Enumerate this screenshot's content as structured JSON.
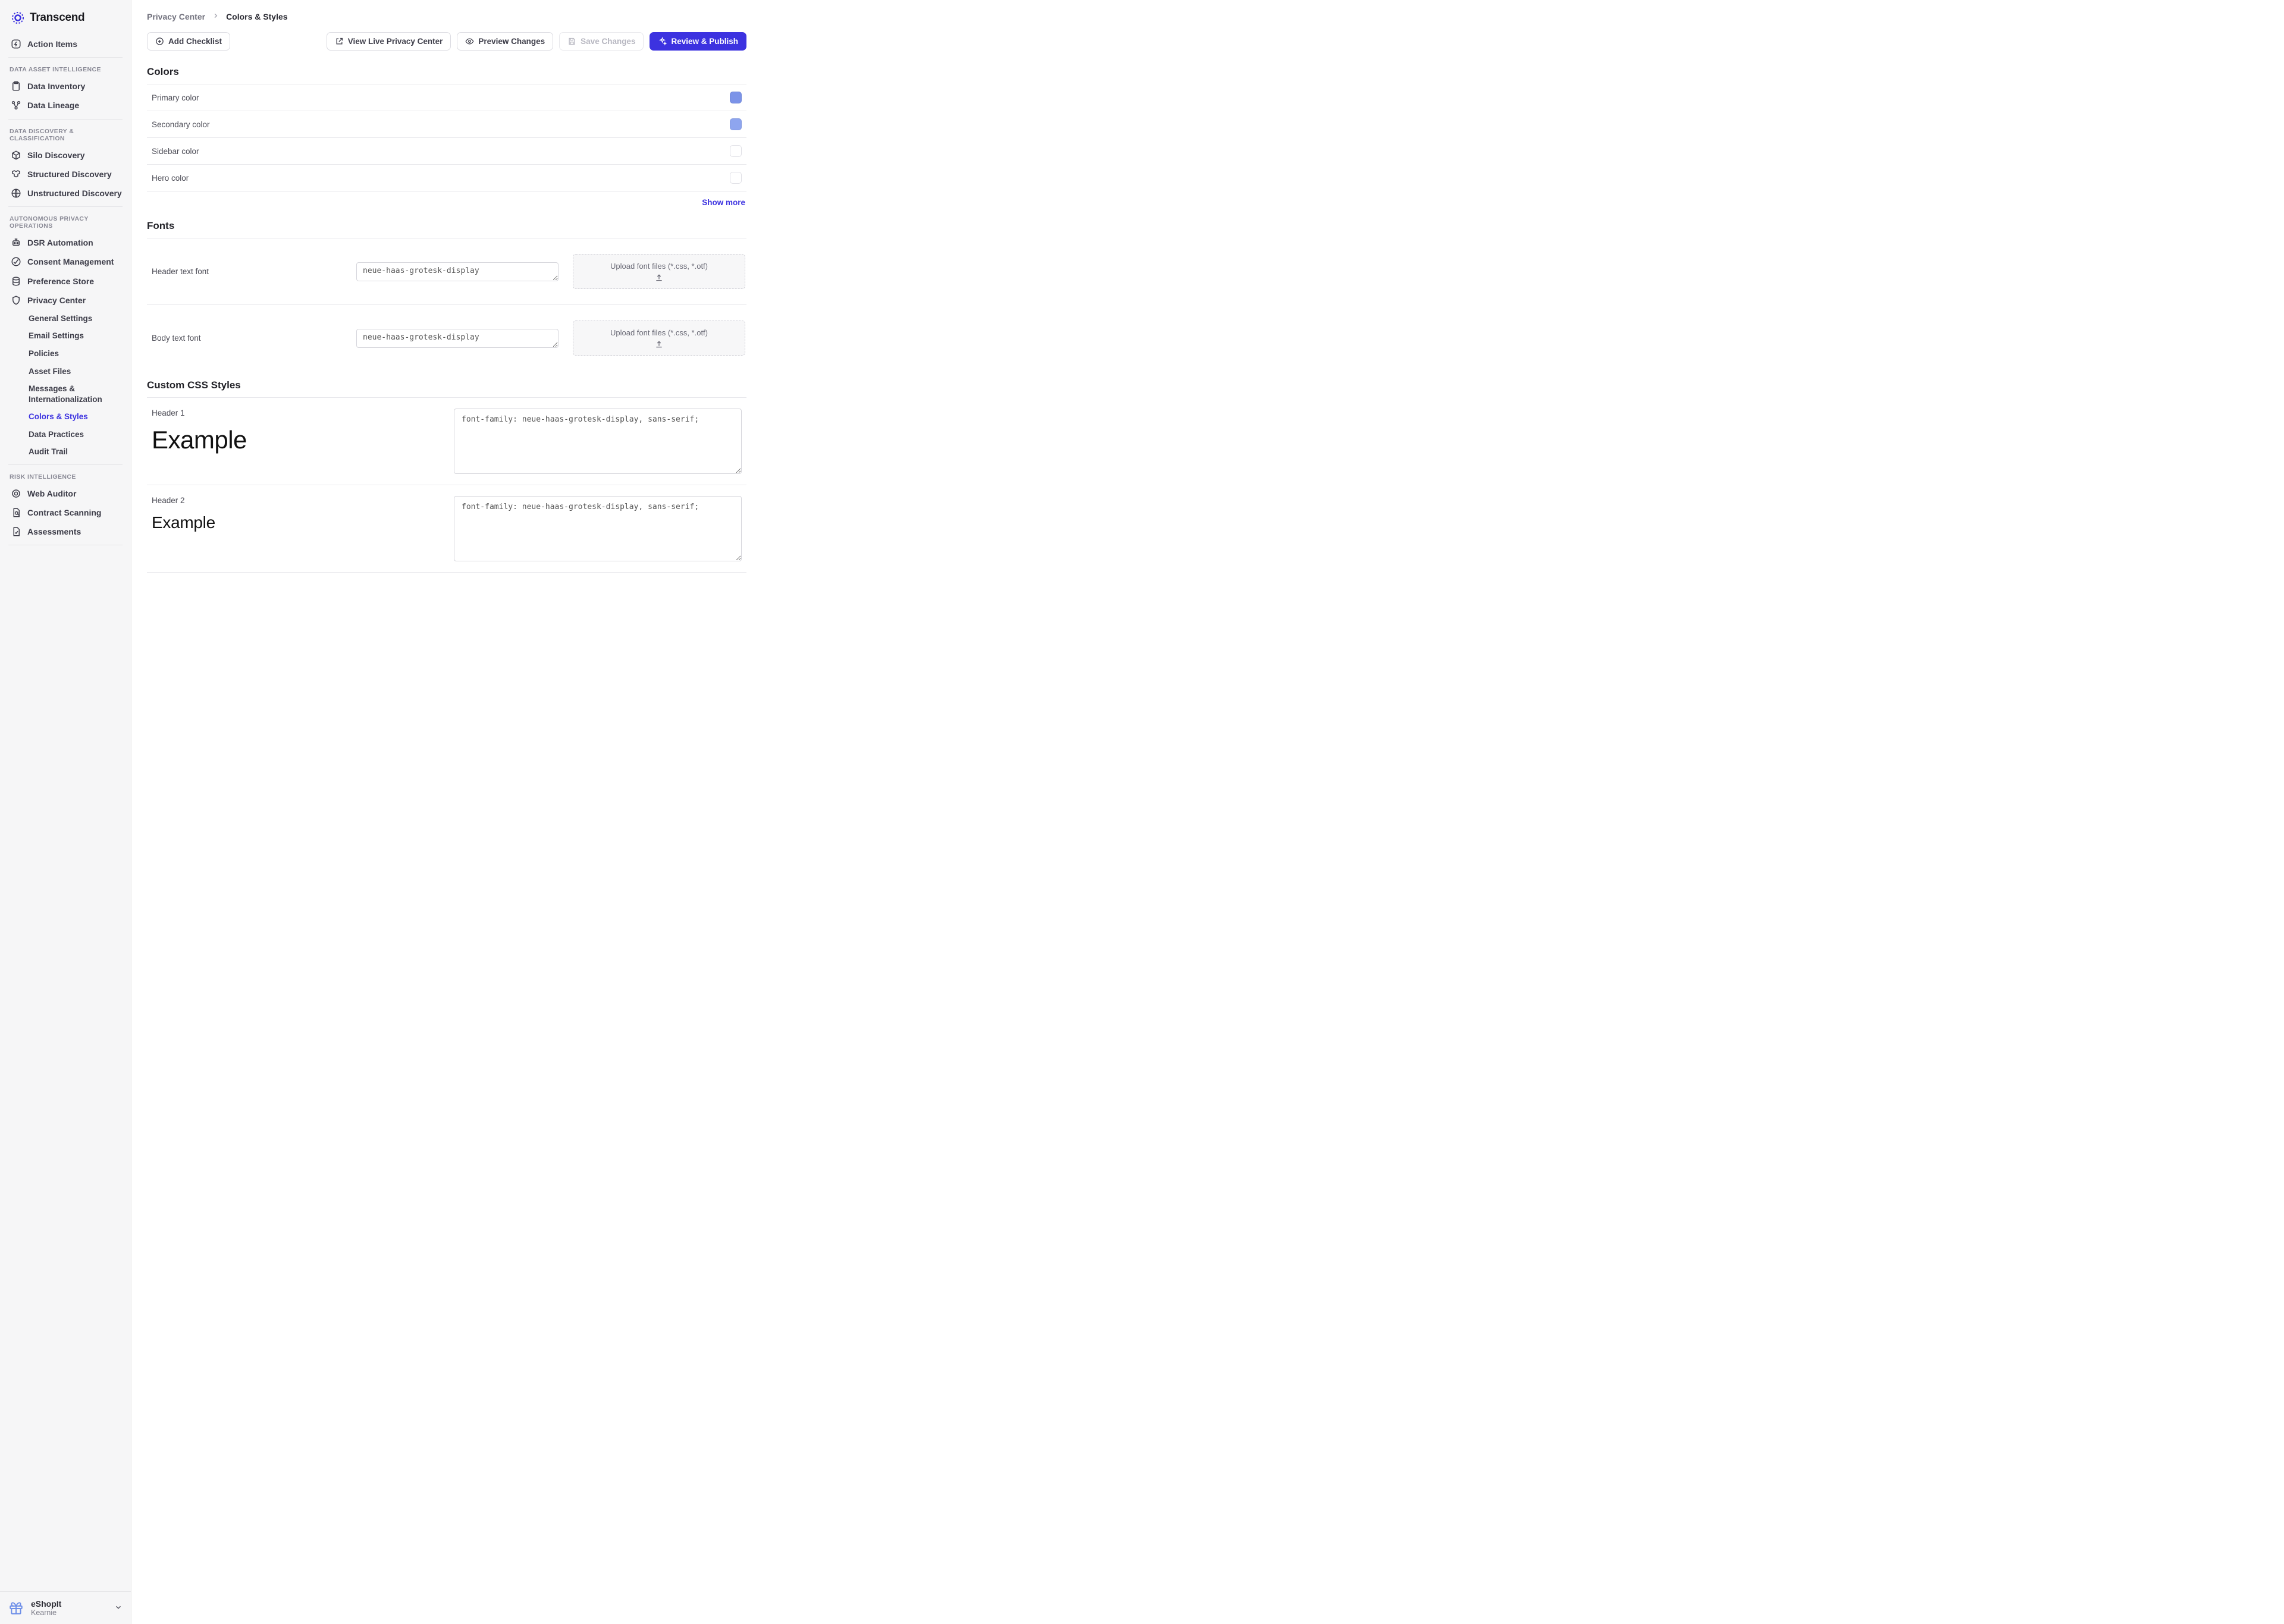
{
  "brand": "Transcend",
  "sidebar": {
    "action_items": "Action Items",
    "sections": [
      {
        "label": "DATA ASSET INTELLIGENCE",
        "items": [
          {
            "icon": "inventory",
            "label": "Data Inventory"
          },
          {
            "icon": "lineage",
            "label": "Data Lineage"
          }
        ]
      },
      {
        "label": "DATA DISCOVERY & CLASSIFICATION",
        "items": [
          {
            "icon": "cube",
            "label": "Silo Discovery"
          },
          {
            "icon": "hexgrid",
            "label": "Structured Discovery"
          },
          {
            "icon": "globe",
            "label": "Unstructured Discovery"
          }
        ]
      },
      {
        "label": "AUTONOMOUS PRIVACY OPERATIONS",
        "items": [
          {
            "icon": "robot",
            "label": "DSR Automation"
          },
          {
            "icon": "consent",
            "label": "Consent Management"
          },
          {
            "icon": "store",
            "label": "Preference Store"
          },
          {
            "icon": "privacy",
            "label": "Privacy Center"
          }
        ],
        "subitems": [
          "General Settings",
          "Email Settings",
          "Policies",
          "Asset Files",
          "Messages & Internationalization",
          "Colors & Styles",
          "Data Practices",
          "Audit Trail"
        ],
        "active_sub_index": 5
      },
      {
        "label": "RISK INTELLIGENCE",
        "items": [
          {
            "icon": "target",
            "label": "Web Auditor"
          },
          {
            "icon": "docsearch",
            "label": "Contract Scanning"
          },
          {
            "icon": "checkdoc",
            "label": "Assessments"
          }
        ]
      }
    ],
    "footer": {
      "title": "eShopIt",
      "subtitle": "Kearnie"
    }
  },
  "breadcrumbs": {
    "root": "Privacy Center",
    "current": "Colors & Styles"
  },
  "toolbar": {
    "add_checklist": "Add Checklist",
    "view_live": "View Live Privacy Center",
    "preview": "Preview Changes",
    "save": "Save Changes",
    "publish": "Review & Publish"
  },
  "colors": {
    "heading": "Colors",
    "rows": [
      {
        "label": "Primary color",
        "value": "#7b93e8"
      },
      {
        "label": "Secondary color",
        "value": "#8ea5ef"
      },
      {
        "label": "Sidebar color",
        "value": "#ffffff"
      },
      {
        "label": "Hero color",
        "value": "#ffffff"
      }
    ],
    "show_more": "Show more"
  },
  "fonts": {
    "heading": "Fonts",
    "header_label": "Header text font",
    "header_value": "neue-haas-grotesk-display",
    "body_label": "Body text font",
    "body_value": "neue-haas-grotesk-display",
    "upload_text": "Upload font files (*.css, *.otf)"
  },
  "css": {
    "heading": "Custom CSS Styles",
    "example_text": "Example",
    "rows": [
      {
        "label": "Header 1",
        "value": "font-family: neue-haas-grotesk-display, sans-serif;",
        "size": "h1"
      },
      {
        "label": "Header 2",
        "value": "font-family: neue-haas-grotesk-display, sans-serif;",
        "size": "h2"
      }
    ]
  }
}
